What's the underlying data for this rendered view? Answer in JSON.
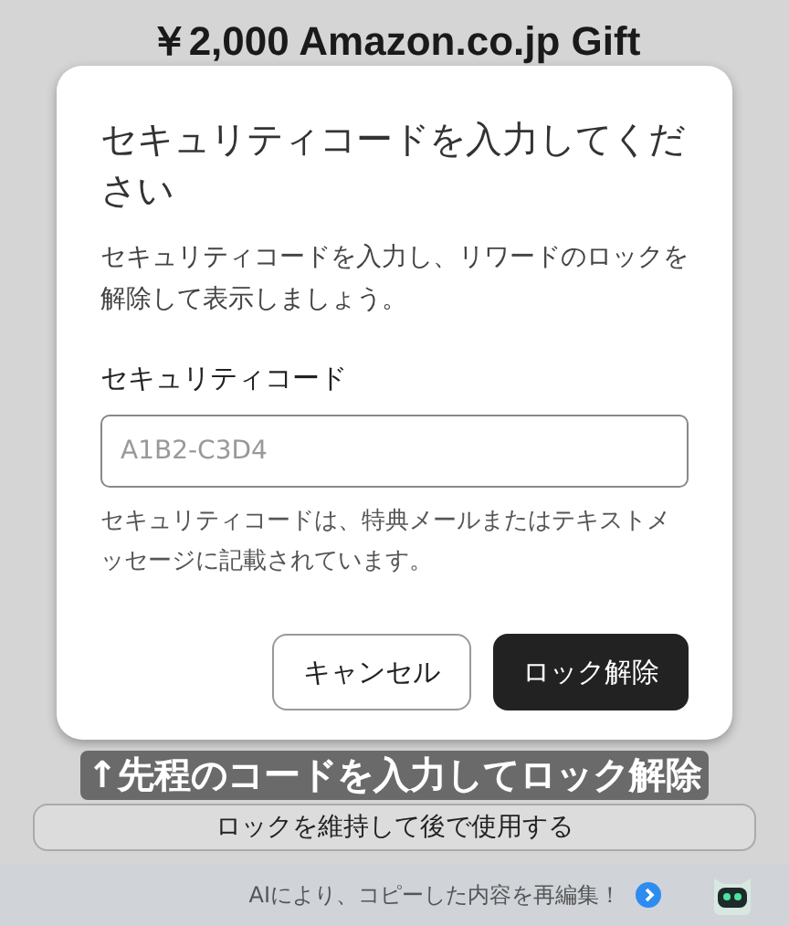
{
  "background": {
    "title": "￥2,000 Amazon.co.jp Gift",
    "secondary_button": "ロックを維持して後で使用する"
  },
  "dialog": {
    "title": "セキュリティコードを入力してください",
    "description": "セキュリティコードを入力し、リワードのロックを解除して表示しましょう。",
    "field_label": "セキュリティコード",
    "placeholder": "A1B2-C3D4",
    "helper": "セキュリティコードは、特典メールまたはテキストメッセージに記載されています。",
    "buttons": [
      {
        "label": "キャンセル",
        "kind": "outline"
      },
      {
        "label": "ロック解除",
        "kind": "primary"
      }
    ]
  },
  "annotation": "↑先程のコードを入力してロック解除",
  "bottom_bar": {
    "text": "AIにより、コピーした内容を再編集！"
  }
}
